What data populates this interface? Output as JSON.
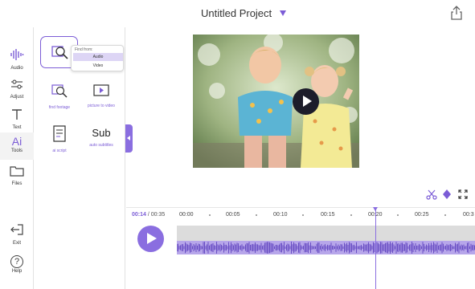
{
  "header": {
    "title": "Untitled Project",
    "share_icon": "share-icon"
  },
  "rail": {
    "items": [
      {
        "label": "Audio",
        "icon": "waveform-icon"
      },
      {
        "label": "Adjust",
        "icon": "sliders-icon"
      },
      {
        "label": "Text",
        "icon": "text-icon"
      },
      {
        "label": "Tools",
        "icon": "ai-icon",
        "glyph": "Ai",
        "active": true
      },
      {
        "label": "Files",
        "icon": "folder-icon"
      },
      {
        "label": "Exit",
        "icon": "exit-icon"
      },
      {
        "label": "Help",
        "icon": "help-icon",
        "glyph": "?"
      }
    ]
  },
  "tools": {
    "items": [
      {
        "label": "",
        "icon": "find-footage-icon"
      },
      {
        "label": "find footage",
        "icon": "search-document-icon"
      },
      {
        "label": "picture to video",
        "icon": "picture-to-video-icon"
      },
      {
        "label": "ai script",
        "icon": "script-icon"
      },
      {
        "label": "auto subtitles",
        "icon": "subtitles-icon",
        "glyph": "Sub"
      }
    ],
    "find_from": {
      "title": "Find from:",
      "options": [
        "Audio",
        "Video"
      ],
      "selected": "Audio"
    }
  },
  "controls": {
    "icons": [
      "scissors-icon",
      "keyframe-icon",
      "fullscreen-icon"
    ]
  },
  "timeline": {
    "current": "00:14",
    "separator": " / ",
    "total": "00:35",
    "ticks": [
      "00:00",
      "00:05",
      "00:10",
      "00:15",
      "00:20",
      "00:25",
      "00:3"
    ],
    "playhead_time": "00:20"
  },
  "colors": {
    "accent": "#7b5cd6",
    "accent_light": "#8a6ee0",
    "waveform": "#6a4fc4",
    "track_bg": "#dcdcdc"
  }
}
